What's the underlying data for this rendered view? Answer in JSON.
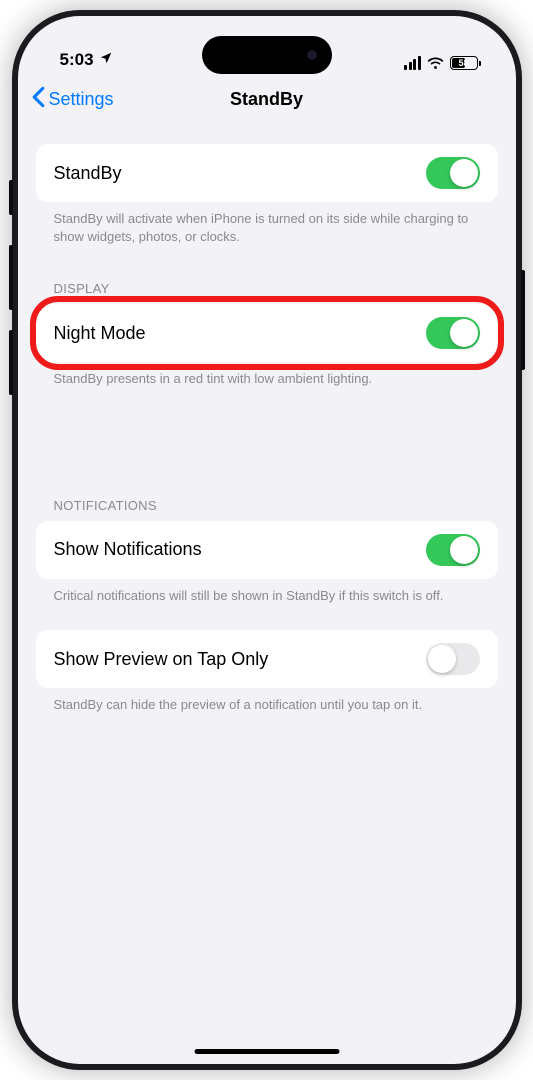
{
  "statusBar": {
    "time": "5:03",
    "batteryPercent": "58"
  },
  "nav": {
    "backLabel": "Settings",
    "title": "StandBy"
  },
  "sections": {
    "standby": {
      "label": "StandBy",
      "footer": "StandBy will activate when iPhone is turned on its side while charging to show widgets, photos, or clocks.",
      "toggle": true
    },
    "display": {
      "header": "DISPLAY",
      "nightMode": {
        "label": "Night Mode",
        "toggle": true
      },
      "footer": "StandBy presents in a red tint with low ambient lighting."
    },
    "notifications": {
      "header": "NOTIFICATIONS",
      "showNotifications": {
        "label": "Show Notifications",
        "toggle": true,
        "footer": "Critical notifications will still be shown in StandBy if this switch is off."
      },
      "showPreview": {
        "label": "Show Preview on Tap Only",
        "toggle": false,
        "footer": "StandBy can hide the preview of a notification until you tap on it."
      }
    }
  }
}
